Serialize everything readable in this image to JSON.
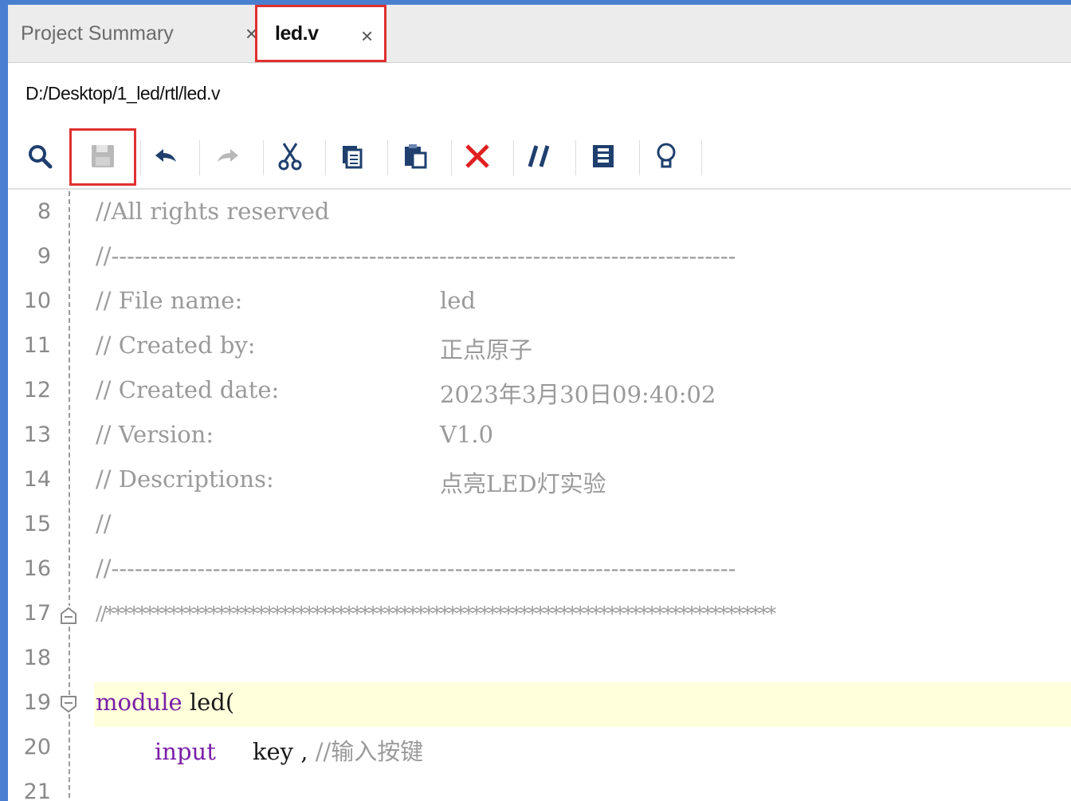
{
  "tabs": [
    {
      "label": "Project Summary",
      "close": "×"
    },
    {
      "label": "led.v",
      "close": "×"
    }
  ],
  "filepath": "D:/Desktop/1_led/rtl/led.v",
  "toolbar": {
    "icons": [
      "search-icon",
      "save-icon",
      "undo-icon",
      "redo-icon",
      "cut-icon",
      "copy-icon",
      "paste-icon",
      "delete-icon",
      "comment-icon",
      "block-icon",
      "bulb-icon"
    ],
    "accent_delete": "#e02020",
    "highlight_border": "#e03030"
  },
  "editor": {
    "lines": [
      {
        "num": "8",
        "c1": "//All rights reserved",
        "c2": ""
      },
      {
        "num": "9",
        "c1": "//--------------------------------------------------------------------------------",
        "c2": ""
      },
      {
        "num": "10",
        "c1": "// File name:",
        "c2": "led"
      },
      {
        "num": "11",
        "c1": "// Created by:",
        "c2": "正点原子"
      },
      {
        "num": "12",
        "c1": "// Created date:",
        "c2": "2023年3月30日09:40:02"
      },
      {
        "num": "13",
        "c1": "// Version:",
        "c2": "V1.0"
      },
      {
        "num": "14",
        "c1": "// Descriptions:",
        "c2": "点亮LED灯实验"
      },
      {
        "num": "15",
        "c1": "//",
        "c2": ""
      },
      {
        "num": "16",
        "c1": "//--------------------------------------------------------------------------------",
        "c2": ""
      },
      {
        "num": "17",
        "c1": "//************************************************************************************",
        "c2": ""
      },
      {
        "num": "18",
        "c1": "",
        "c2": ""
      },
      {
        "num": "19",
        "kw": "module",
        "rest": " led("
      },
      {
        "num": "20",
        "kw": "input",
        "rest": "     key , ",
        "cm": "//输入按键"
      },
      {
        "num": "21",
        "c1": "",
        "c2": ""
      }
    ],
    "highlight_color": "#ffffdc",
    "keyword_color": "#7a1ea8"
  }
}
